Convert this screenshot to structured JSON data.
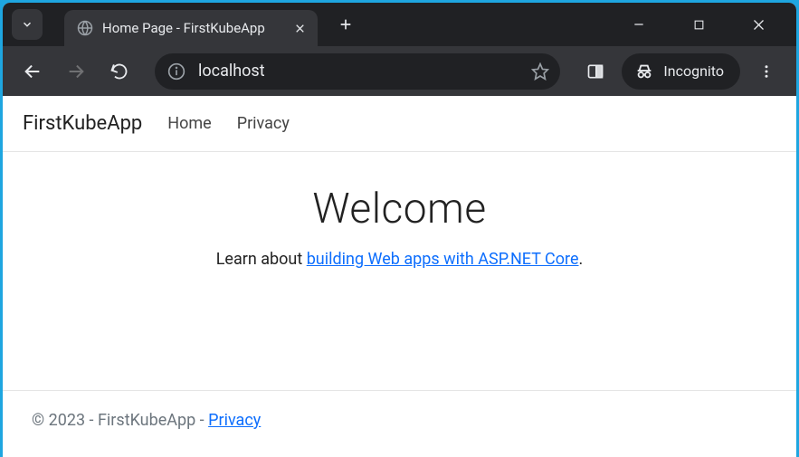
{
  "tab": {
    "title": "Home Page - FirstKubeApp"
  },
  "omnibox": {
    "url": "localhost"
  },
  "incognito": {
    "label": "Incognito"
  },
  "navbar": {
    "brand": "FirstKubeApp",
    "links": [
      "Home",
      "Privacy"
    ]
  },
  "main": {
    "headline": "Welcome",
    "subPrefix": "Learn about ",
    "subLinkText": "building Web apps with ASP.NET Core",
    "subSuffix": "."
  },
  "footer": {
    "copyright": "© 2023 - FirstKubeApp - ",
    "privacyLink": "Privacy"
  }
}
